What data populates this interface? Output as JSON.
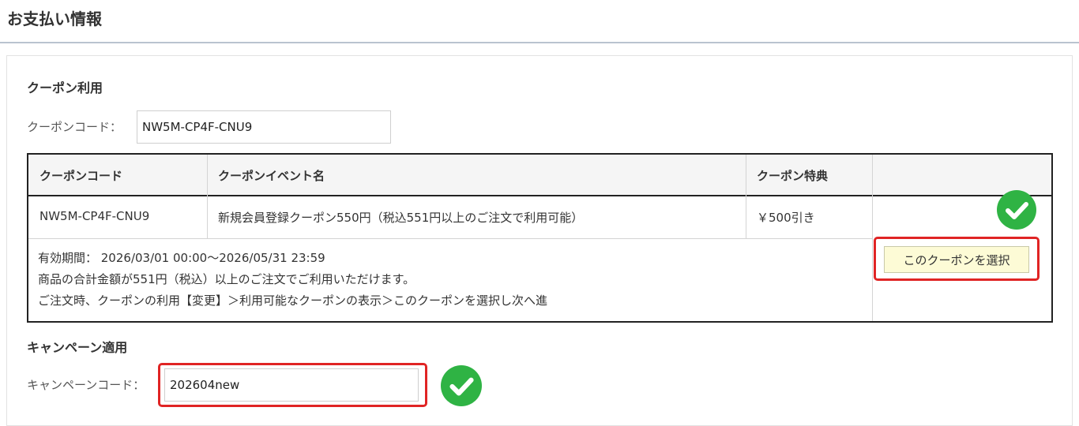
{
  "page": {
    "title": "お支払い情報"
  },
  "coupon": {
    "section_title": "クーポン利用",
    "code_label": "クーポンコード：",
    "code_value": "NW5M-CP4F-CNU9",
    "table": {
      "headers": [
        "クーポンコード",
        "クーポンイベント名",
        "クーポン特典",
        ""
      ],
      "row": {
        "code": "NW5M-CP4F-CNU9",
        "event_name": "新規会員登録クーポン550円（税込551円以上のご注文で利用可能）",
        "benefit": "￥500引き"
      },
      "details": [
        "有効期間： 2026/03/01 00:00～2026/05/31 23:59",
        "商品の合計金額が551円（税込）以上のご注文でご利用いただけます。",
        "ご注文時、クーポンの利用【変更】＞利用可能なクーポンの表示＞このクーポンを選択し次へ進"
      ],
      "select_button": "このクーポンを選択"
    }
  },
  "campaign": {
    "section_title": "キャンペーン適用",
    "code_label": "キャンペーンコード：",
    "code_value": "202604new"
  },
  "colors": {
    "accent_red": "#e02424",
    "check_green": "#2fb344",
    "button_bg": "#fdfbd6"
  },
  "icons": {
    "verified": "check-circle-icon"
  }
}
